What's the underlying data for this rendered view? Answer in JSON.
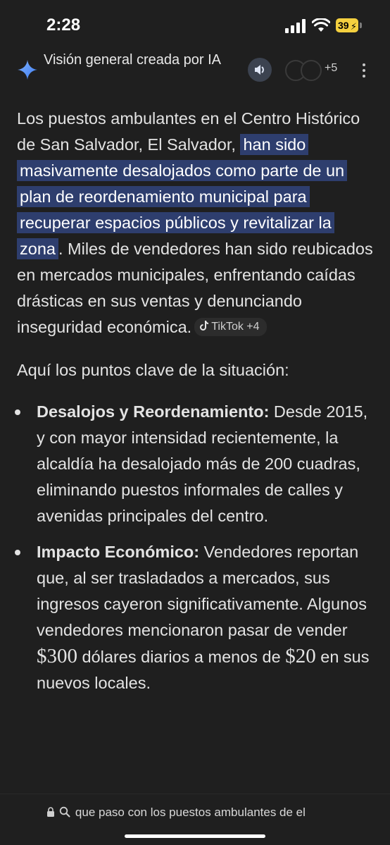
{
  "status": {
    "time": "2:28",
    "battery": "39",
    "battery_color": "#f4d03f"
  },
  "header": {
    "title": "Visión general creada por IA",
    "source_count": "+5",
    "icons": [
      "sparkle-icon",
      "speaker-icon",
      "more-vert-icon"
    ]
  },
  "content": {
    "para1_before": "Los puestos ambulantes en el Centro Histórico de San Salvador, El Salvador, ",
    "para1_highlight": "han sido masivamente desalojados como parte de un plan de reordenamiento municipal para recuperar espacios públicos y revitalizar la zona",
    "para1_after": ". Miles de vendedores han sido reubicados en mercados municipales, enfrentando caídas drásticas en sus ventas y denunciando inseguridad económica.",
    "source_chip": "TikTok +4",
    "intro": "Aquí los puntos clave de la situación:",
    "points": [
      {
        "title": "Desalojos y Reordenamiento:",
        "text": " Desde 2015, y con mayor intensidad recientemente, la alcaldía ha desalojado más de 200 cuadras, eliminando puestos informales de calles y avenidas principales del centro."
      },
      {
        "title": "Impacto Económico:",
        "text_before": " Vendedores reportan que, al ser trasladados a mercados, sus ingresos cayeron significativamente. Algunos vendedores mencionaron pasar de vender ",
        "amount1": "$300",
        "text_middle": " dólares diarios a menos de ",
        "amount2": "$20",
        "text_after": " en sus nuevos locales."
      }
    ],
    "highlight_color": "#2e3e6e"
  },
  "bottom": {
    "url": "que paso con los puestos ambulantes de el"
  }
}
